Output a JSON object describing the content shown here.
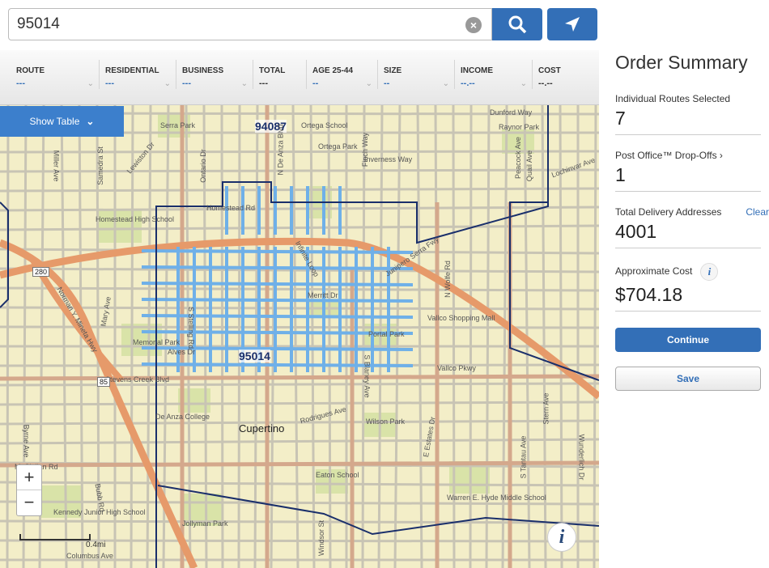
{
  "search": {
    "value": "95014"
  },
  "filters": [
    {
      "label": "ROUTE",
      "value": "---"
    },
    {
      "label": "RESIDENTIAL",
      "value": "---"
    },
    {
      "label": "BUSINESS",
      "value": "---"
    },
    {
      "label": "TOTAL",
      "value": "---"
    },
    {
      "label": "AGE 25-44",
      "value": "--"
    },
    {
      "label": "SIZE",
      "value": "--"
    },
    {
      "label": "INCOME",
      "value": "--.--"
    },
    {
      "label": "COST",
      "value": "--.--"
    }
  ],
  "show_table": "Show Table",
  "map": {
    "scale": "0.4mi",
    "labels": [
      "94087",
      "95014",
      "Cupertino",
      "Junipero Serra Fwy",
      "Stevens Creek Blvd",
      "Vallco Pkwy",
      "Homestead Rd",
      "Inverness Way",
      "Dunford Way",
      "Lochinvar Ave",
      "Rodrigues Ave",
      "McClellan Rd",
      "Columbus Ave",
      "Alves Dr",
      "Homestead High School",
      "De Anza College",
      "Memorial Park",
      "Portal Park",
      "Wilson Park",
      "Eaton School",
      "Jollyman Park",
      "Vallco Shopping Mall",
      "Serra Park",
      "Ortega School",
      "Ortega Park",
      "Raynor Park",
      "Kennedy Junior High School",
      "Warren E. Hyde Middle School",
      "Norman Y. Mineta Hwy",
      "N De Anza Blvd",
      "S Stelling Rd",
      "S Blaney Ave",
      "N Wolfe Rd",
      "Finch Way",
      "Mary Ave",
      "Bubb Rd",
      "Byrne Ave",
      "Stern Ave",
      "Wunderlich Dr",
      "Peacock Ave",
      "Quail Ave",
      "Ontario Dr",
      "Lewiston Dr",
      "Samedra St",
      "Miller Ave",
      "Infinite Loop",
      "Merritt Dr",
      "E Estates Dr",
      "S Tantau Ave",
      "Windsor St",
      "85",
      "280"
    ]
  },
  "summary": {
    "title": "Order Summary",
    "routes_label": "Individual Routes Selected",
    "routes_value": "7",
    "po_label": "Post Office™ Drop-Offs ›",
    "po_value": "1",
    "addresses_label": "Total Delivery Addresses",
    "clear": "Clear",
    "addresses_value": "4001",
    "cost_label": "Approximate Cost",
    "cost_value": "$704.18",
    "continue": "Continue",
    "save": "Save"
  },
  "colors": {
    "accent": "#336fb7",
    "route_highlight": "#6fb0e8",
    "zip_boundary": "#1a2f6b",
    "map_bg": "#f3eec8",
    "freeway": "#e69a6a"
  }
}
